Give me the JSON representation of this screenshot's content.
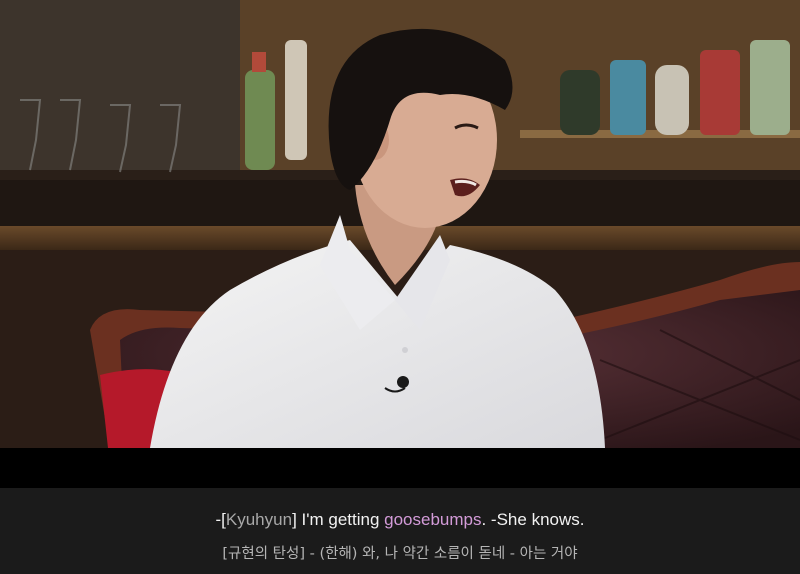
{
  "subtitles": {
    "primary": {
      "prefix": "-[",
      "speaker": "Kyuhyun",
      "mid": "] I'm getting ",
      "highlight": "goosebumps",
      "suffix": ". -She knows."
    },
    "secondary": "[규현의 탄성] - (한해) 와, 나 약간 소름이 돋네 - 아는 거야"
  },
  "colors": {
    "highlight": "#d39bd8",
    "speaker": "#a8a8a8",
    "subtitle_text": "#f2f2f2",
    "subtitle_bg": "#1b1b1b"
  }
}
